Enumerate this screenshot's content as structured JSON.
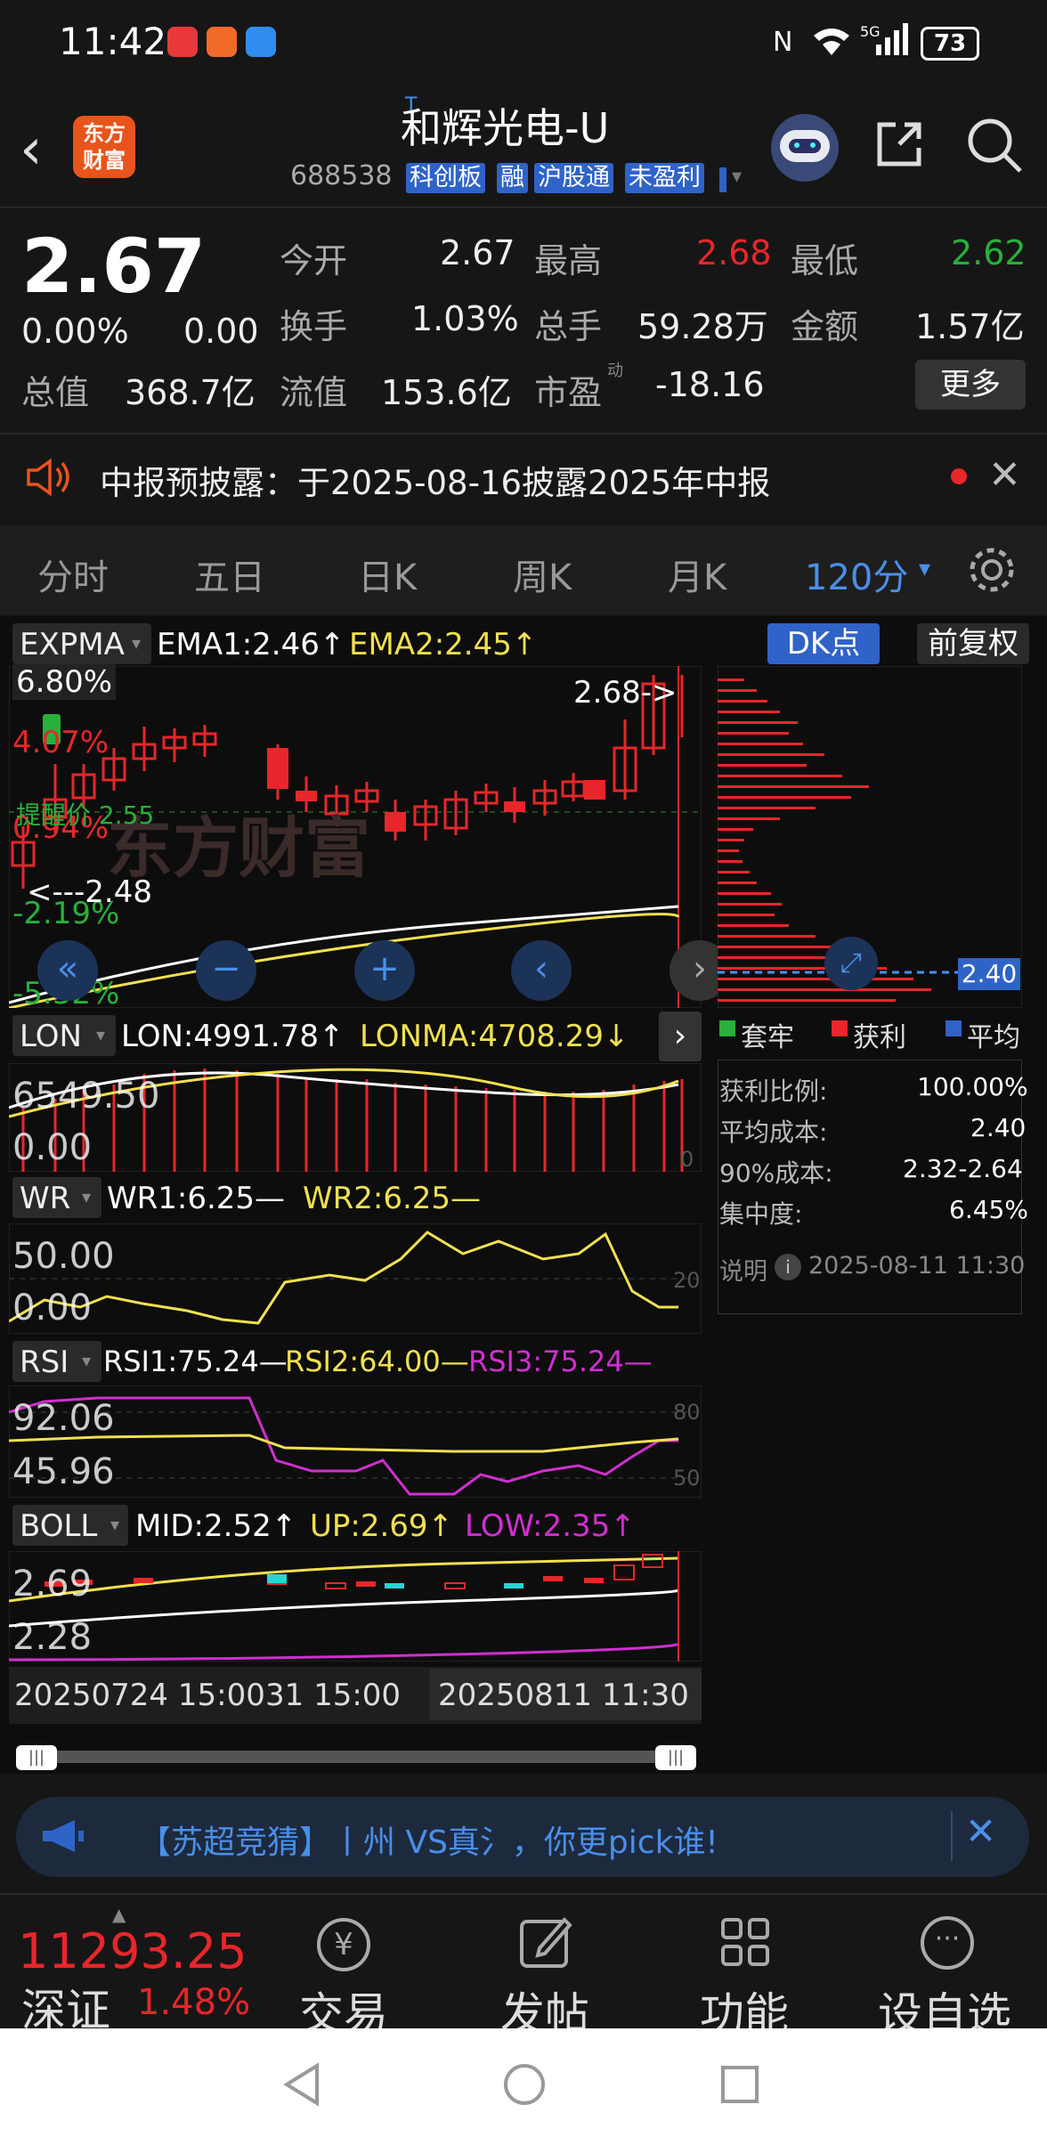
{
  "status": {
    "time": "11:42",
    "battery": "73"
  },
  "header": {
    "tmark": "T",
    "name": "和辉光电-U",
    "code": "688538",
    "tags": [
      "科创板",
      "融",
      "沪股通",
      "未盈利"
    ],
    "logo_line1": "东方",
    "logo_line2": "财富"
  },
  "quote": {
    "price": "2.67",
    "change_pct": "0.00%",
    "change": "0.00",
    "open_label": "今开",
    "open": "2.67",
    "high_label": "最高",
    "high": "2.68",
    "low_label": "最低",
    "low": "2.62",
    "turnover_label": "换手",
    "turnover": "1.03%",
    "volume_label": "总手",
    "volume": "59.28万",
    "amount_label": "金额",
    "amount": "1.57亿",
    "mktcap_label": "总值",
    "mktcap": "368.7亿",
    "float_label": "流值",
    "float": "153.6亿",
    "pe_label": "市盈",
    "pe_sup": "动",
    "pe": "-18.16",
    "more": "更多"
  },
  "notice": {
    "text": "中报预披露：于2025-08-16披露2025年中报"
  },
  "tabs": [
    "分时",
    "五日",
    "日K",
    "周K",
    "月K",
    "120分"
  ],
  "chart": {
    "expma": {
      "name": "EXPMA",
      "ema1": "EMA1:2.46↑",
      "ema2": "EMA2:2.45↑"
    },
    "dk": "DK点",
    "fq": "前复权",
    "pct_top": "6.80%",
    "pct_4": "4.07%",
    "pct_1": "0.94%",
    "pct_n2": "-2.19%",
    "pct_n5": "-5.32%",
    "alert": "提醒价 2.55",
    "max_mark": "2.68->",
    "min_mark": "<---2.48",
    "avg_label": "2.40",
    "lon": {
      "name": "LON",
      "lon": "LON:4991.78↑",
      "lonma": "LONMA:4708.29↓",
      "y1": "6549.50",
      "y2": "0.00",
      "r": "0"
    },
    "wr": {
      "name": "WR",
      "wr1": "WR1:6.25—",
      "wr2": "WR2:6.25—",
      "y1": "50.00",
      "y2": "0.00",
      "r": "20"
    },
    "rsi": {
      "name": "RSI",
      "rsi1": "RSI1:75.24—",
      "rsi2": "RSI2:64.00—",
      "rsi3": "RSI3:75.24—",
      "y1": "92.06",
      "y2": "45.96",
      "r1": "80",
      "r2": "50"
    },
    "boll": {
      "name": "BOLL",
      "mid": "MID:2.52↑",
      "up": "UP:2.69↑",
      "low": "LOW:2.35↑",
      "y1": "2.69",
      "y2": "2.28"
    },
    "dates": {
      "left": "20250724 15:00",
      "mid": "31 15:00",
      "right": "20250811 11:30"
    }
  },
  "chip": {
    "legend": [
      "套牢",
      "获利",
      "平均"
    ],
    "rows": [
      {
        "k": "获利比例:",
        "v": "100.00%"
      },
      {
        "k": "平均成本:",
        "v": "2.40"
      },
      {
        "k": "90%成本:",
        "v": "2.32-2.64"
      },
      {
        "k": "集中度:",
        "v": "6.45%"
      }
    ],
    "note": "说明",
    "note_time": "2025-08-11 11:30"
  },
  "banner": {
    "text": "【苏超竞猜】丨州 VS真氵，你更pick谁!"
  },
  "bottom": {
    "index_value": "11293.25",
    "index_name": "深证",
    "index_pct": "1.48%",
    "nav": [
      "交易",
      "发帖",
      "功能",
      "设自选"
    ],
    "trade_icon": "¥"
  },
  "colors": {
    "red": "#e8262b",
    "green": "#27b03a",
    "yellow": "#f0e050",
    "magenta": "#d02fd0",
    "blue": "#4a8fe8"
  }
}
